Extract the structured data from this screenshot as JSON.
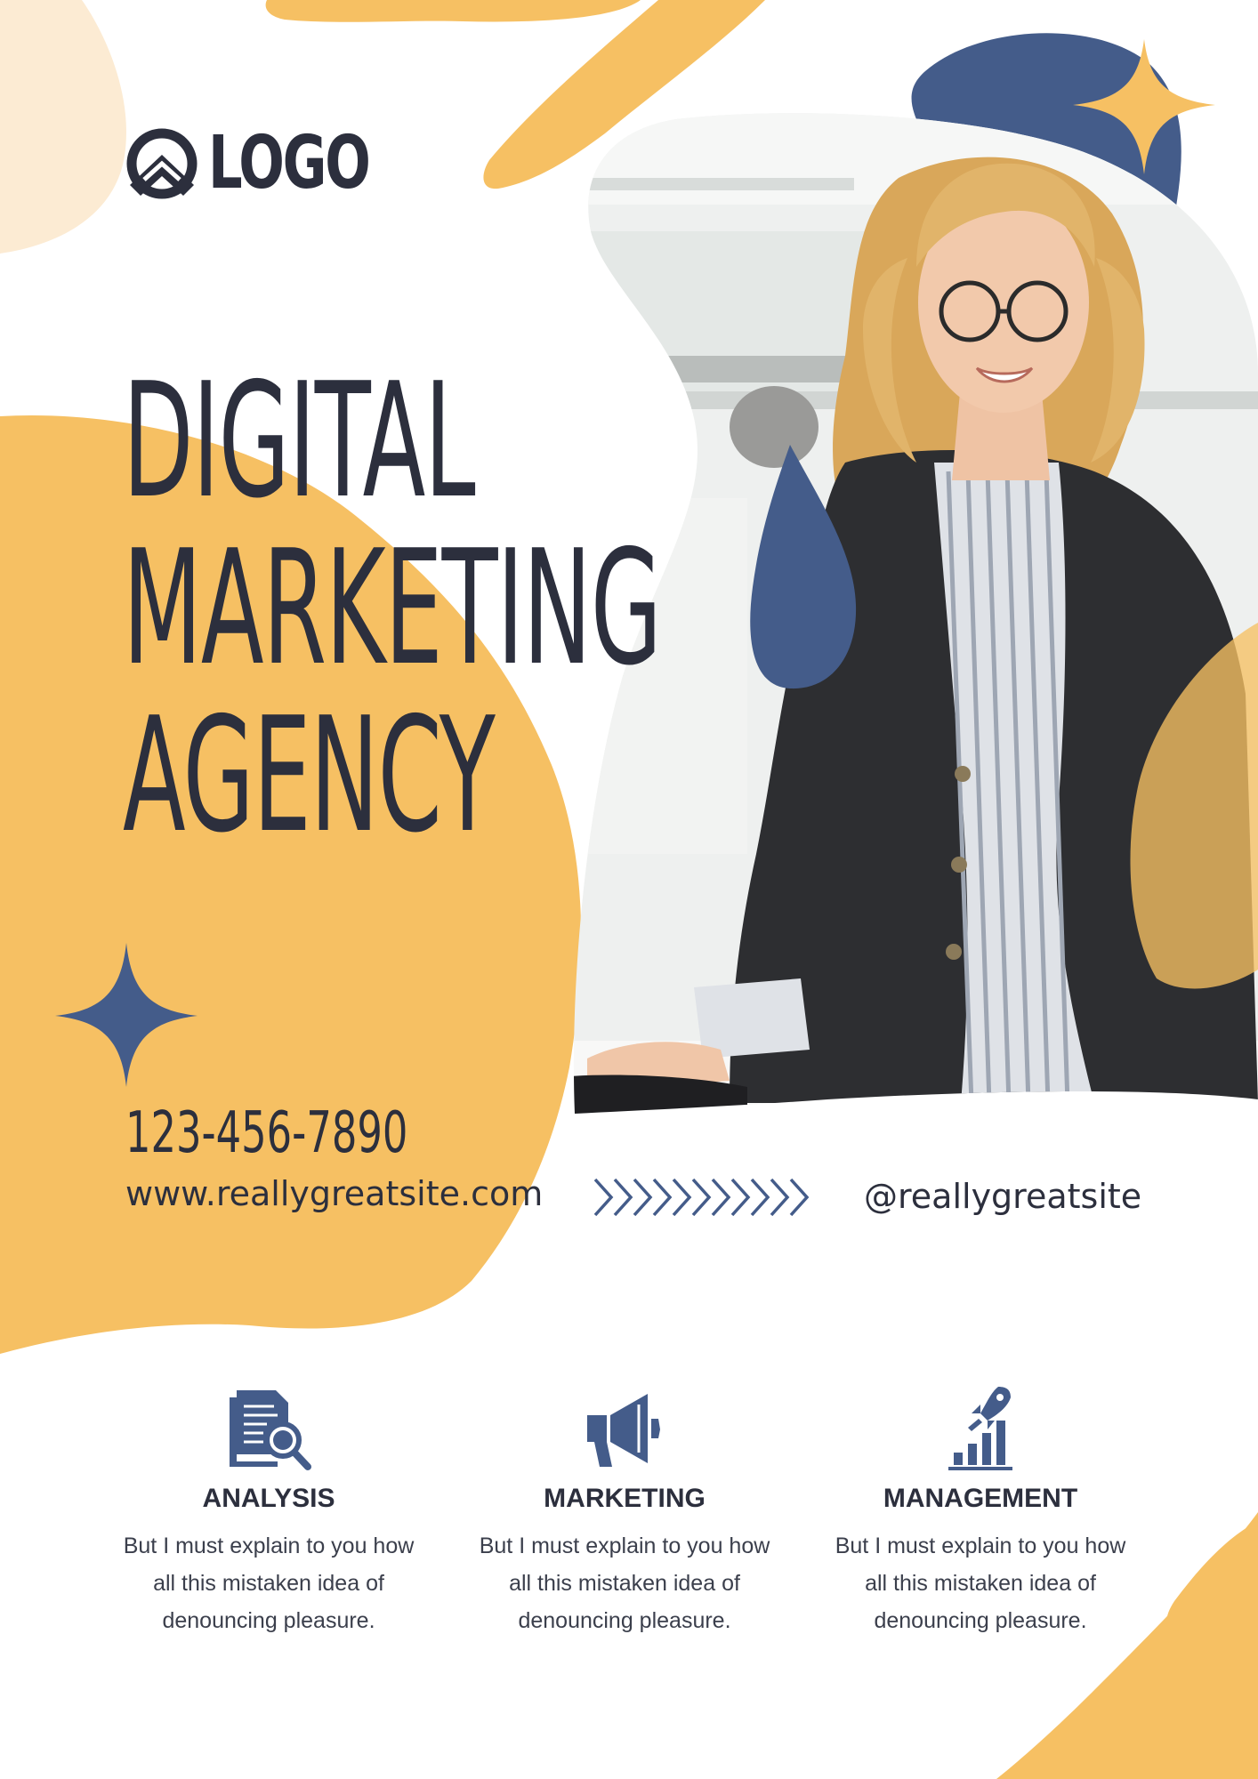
{
  "colors": {
    "accent_orange": "#f6c063",
    "accent_navy": "#445c8a",
    "light_peach": "#fcebd3",
    "text_dark": "#2c2f3d",
    "background": "#ffffff"
  },
  "brand": {
    "logo_text": "LOGO",
    "logo_icon": "house-arrow-logo-icon"
  },
  "headline": {
    "lines": [
      "DIGITAL",
      "MARKETING",
      "AGENCY"
    ]
  },
  "hero": {
    "photo": "woman-in-blazer-smiling-photo"
  },
  "contact": {
    "phone": "123-456-7890",
    "website": "www.reallygreatsite.com",
    "social": "@reallygreatsite",
    "arrow_icon": "chevrons-right-icon"
  },
  "services": [
    {
      "icon": "document-search-icon",
      "title": "ANALYSIS",
      "text": "But I must explain to you how all this mistaken idea of denouncing pleasure."
    },
    {
      "icon": "megaphone-icon",
      "title": "MARKETING",
      "text": "But I must explain to you how all this mistaken idea of denouncing pleasure."
    },
    {
      "icon": "rocket-growth-chart-icon",
      "title": "MANAGEMENT",
      "text": "But I must explain to you how all this mistaken idea of denouncing pleasure."
    }
  ]
}
